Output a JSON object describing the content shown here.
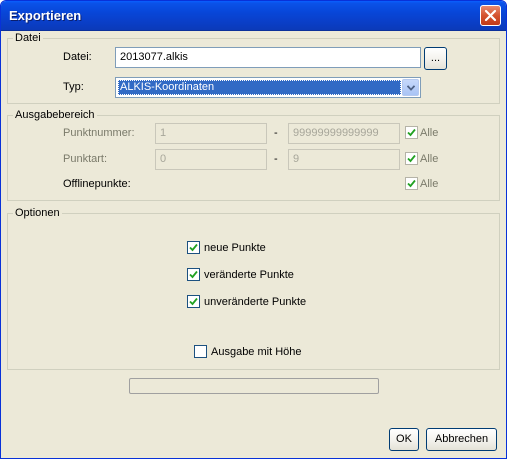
{
  "window": {
    "title": "Exportieren"
  },
  "datei": {
    "legend": "Datei",
    "file_label": "Datei:",
    "file_value": "2013077.alkis",
    "browse_label": "...",
    "type_label": "Typ:",
    "type_value": "ALKIS-Koordinaten"
  },
  "ausgabe": {
    "legend": "Ausgabebereich",
    "punktnummer": {
      "label": "Punktnummer:",
      "from": "1",
      "dash": "-",
      "to": "99999999999999",
      "all_label": "Alle",
      "all_checked": true
    },
    "punktart": {
      "label": "Punktart:",
      "from": "0",
      "dash": "-",
      "to": "9",
      "all_label": "Alle",
      "all_checked": true
    },
    "offline": {
      "label": "Offlinepunkte:",
      "all_label": "Alle",
      "all_checked": true
    }
  },
  "optionen": {
    "legend": "Optionen",
    "items": [
      {
        "label": "neue Punkte",
        "checked": true
      },
      {
        "label": "veränderte Punkte",
        "checked": true
      },
      {
        "label": "unveränderte Punkte",
        "checked": true
      },
      {
        "label": "Ausgabe mit Höhe",
        "checked": false
      }
    ]
  },
  "progress": {
    "value": 0
  },
  "buttons": {
    "ok": "OK",
    "cancel": "Abbrechen"
  }
}
